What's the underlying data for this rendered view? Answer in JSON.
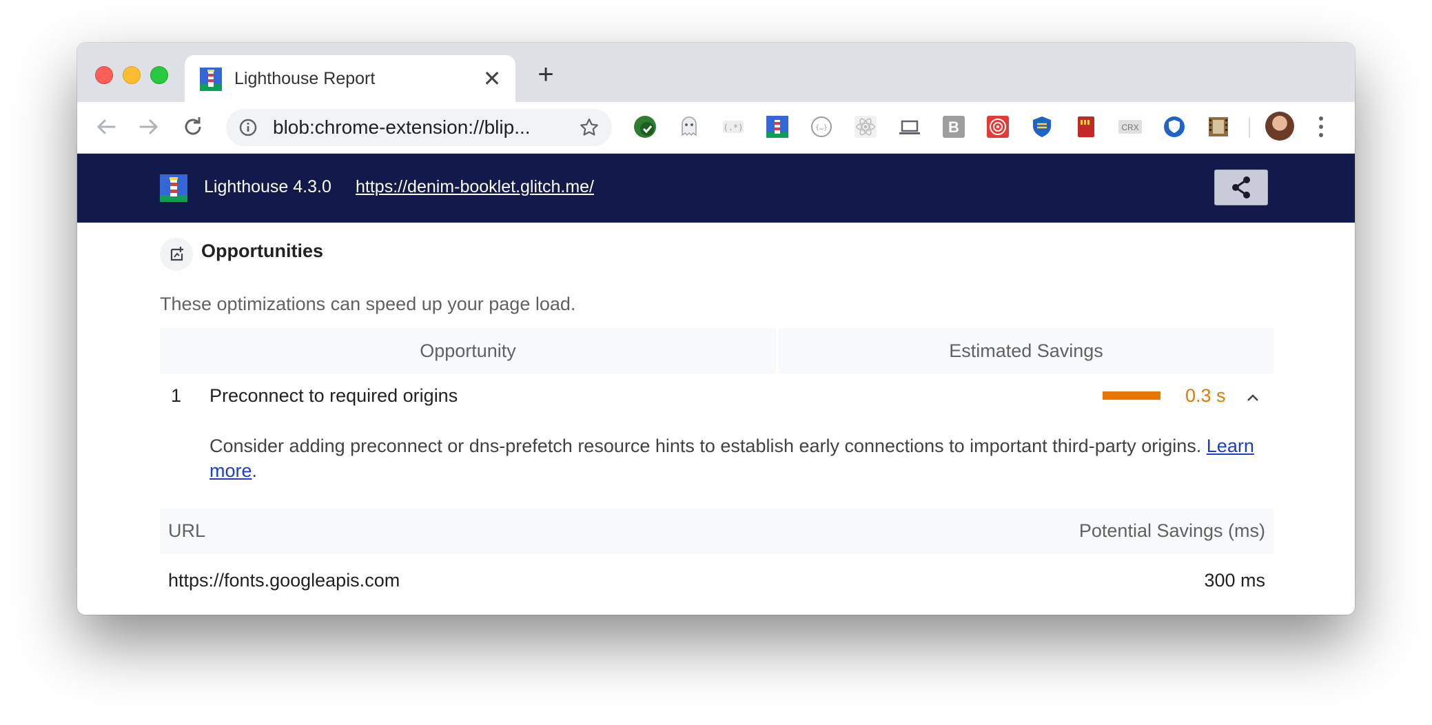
{
  "browser": {
    "tab": {
      "title": "Lighthouse Report",
      "close_glyph": "✕",
      "favicon": "lighthouse-icon"
    },
    "new_tab_glyph": "+",
    "toolbar": {
      "back_icon": "back-arrow-icon",
      "forward_icon": "forward-arrow-icon",
      "reload_icon": "reload-icon",
      "address": "blob:chrome-extension://blip...",
      "info_icon": "info-icon",
      "bookmark_icon": "star-icon",
      "extensions": [
        "green-check-extension-icon",
        "ghost-extension-icon",
        "regex-extension-icon",
        "lighthouse-extension-icon",
        "json-extension-icon",
        "react-extension-icon",
        "laptop-extension-icon",
        "b-extension-icon",
        "target-extension-icon",
        "shield-extension-icon",
        "sd-card-extension-icon",
        "crx-extension-icon",
        "blue-shield-extension-icon",
        "film-extension-icon"
      ],
      "crx_label": "CRX",
      "b_label": "B"
    }
  },
  "lighthouse": {
    "version": "Lighthouse 4.3.0",
    "url": "https://denim-booklet.glitch.me/",
    "section_title": "Opportunities",
    "section_description": "These optimizations can speed up your page load.",
    "table_headers": {
      "opportunity": "Opportunity",
      "savings": "Estimated Savings"
    },
    "audits": [
      {
        "index": "1",
        "title": "Preconnect to required origins",
        "savings": "0.3 s",
        "savings_fraction": 1.0,
        "description": "Consider adding preconnect or dns-prefetch resource hints to establish early connections to important third-party origins.",
        "learn_more": "Learn more",
        "details": {
          "headers": {
            "url": "URL",
            "savings": "Potential Savings (ms)"
          },
          "rows": [
            {
              "url": "https://fonts.googleapis.com",
              "savings": "300 ms"
            }
          ]
        }
      }
    ]
  },
  "colors": {
    "header_bg": "#121a4b",
    "savings_orange": "#e67700",
    "link_blue": "#1a3ec8"
  }
}
